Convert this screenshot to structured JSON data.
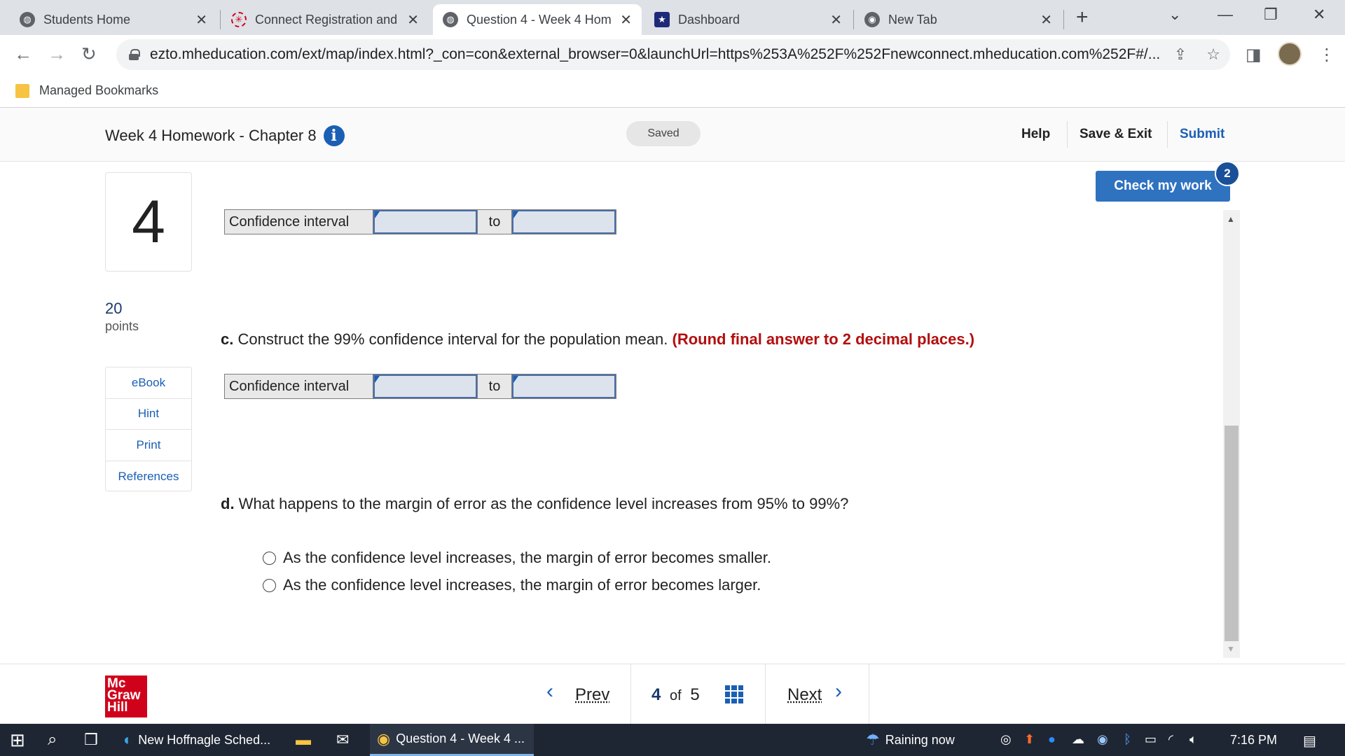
{
  "browser": {
    "tabs": [
      {
        "title": "Students Home",
        "icon": "globe-icon",
        "active": false
      },
      {
        "title": "Connect Registration and",
        "icon": "connect-icon",
        "active": false
      },
      {
        "title": "Question 4 - Week 4 Hom",
        "icon": "globe-icon",
        "active": true
      },
      {
        "title": "Dashboard",
        "icon": "star-badge-icon",
        "active": false
      },
      {
        "title": "New Tab",
        "icon": "chrome-icon",
        "active": false
      }
    ],
    "url": "ezto.mheducation.com/ext/map/index.html?_con=con&external_browser=0&launchUrl=https%253A%252F%252Fnewconnect.mheducation.com%252F#/...",
    "bookmarks_label": "Managed Bookmarks"
  },
  "header": {
    "title": "Week 4 Homework - Chapter 8",
    "saved": "Saved",
    "help": "Help",
    "save_exit": "Save & Exit",
    "submit": "Submit"
  },
  "question": {
    "number": "4",
    "points_value": "20",
    "points_label": "points",
    "resources": [
      "eBook",
      "Hint",
      "Print",
      "References"
    ],
    "check_my_work": "Check my work",
    "check_badge": "2",
    "ci_label": "Confidence interval",
    "ci_to": "to",
    "ci_b_lower": "",
    "ci_b_upper": "",
    "ci_c_lower": "",
    "ci_c_upper": "",
    "part_c_letter": "c.",
    "part_c_text": " Construct the 99% confidence interval for the population mean. ",
    "part_c_note": "(Round final answer to 2 decimal places.)",
    "part_d_letter": "d.",
    "part_d_text": " What happens to the margin of error as the confidence level increases from 95% to 99%?",
    "options": [
      "As the confidence level increases, the margin of error becomes smaller.",
      "As the confidence level increases, the margin of error becomes larger."
    ]
  },
  "footer": {
    "prev": "Prev",
    "current": "4",
    "of": "of",
    "total": "5",
    "next": "Next",
    "logo_lines": [
      "Mc",
      "Graw",
      "Hill"
    ]
  },
  "taskbar": {
    "app1": "New Hoffnagle Sched...",
    "app2": "Question 4 - Week 4 ...",
    "weather": "Raining now",
    "time": "7:16 PM"
  }
}
